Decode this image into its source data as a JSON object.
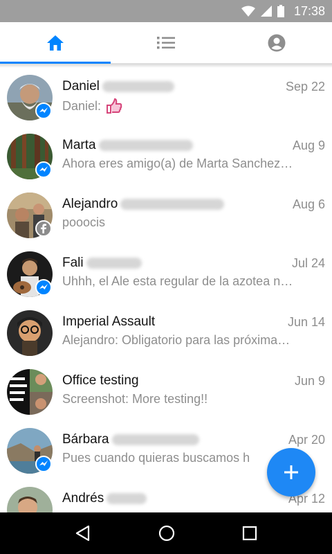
{
  "status_bar": {
    "time": "17:38"
  },
  "tabs": [
    {
      "icon": "home-icon",
      "active": true
    },
    {
      "icon": "list-icon",
      "active": false
    },
    {
      "icon": "profile-icon",
      "active": false
    }
  ],
  "conversations": [
    {
      "name": "Daniel",
      "date": "Sep 22",
      "snippet": "Daniel:",
      "snippet_emoji": "thumbs-up-sticker",
      "badge": "messenger"
    },
    {
      "name": "Marta",
      "date": "Aug 9",
      "snippet": "Ahora eres amigo(a) de Marta Sanchez…",
      "badge": "messenger"
    },
    {
      "name": "Alejandro",
      "date": "Aug 6",
      "snippet": "pooocis",
      "badge": "facebook"
    },
    {
      "name": "Fali",
      "date": "Jul 24",
      "snippet": "Uhhh, el Ale esta regular de la azotea n…",
      "badge": "messenger"
    },
    {
      "name": "Imperial Assault",
      "date": "Jun 14",
      "snippet": "Alejandro: Obligatorio para las próxima…",
      "badge": "none"
    },
    {
      "name": "Office testing",
      "date": "Jun 9",
      "snippet": "Screenshot: More testing!!",
      "badge": "none"
    },
    {
      "name": "Bárbara",
      "date": "Apr 20",
      "snippet": "Pues cuando quieras buscamos h",
      "badge": "messenger"
    },
    {
      "name": "Andrés",
      "date": "Apr 12",
      "snippet": "",
      "badge": "none"
    }
  ],
  "fab": {
    "icon": "plus-icon"
  },
  "colors": {
    "accent": "#0084ff",
    "fab": "#1e88f5",
    "status_bar": "#9e9e9e",
    "facebook_badge": "#8c8c8c"
  }
}
